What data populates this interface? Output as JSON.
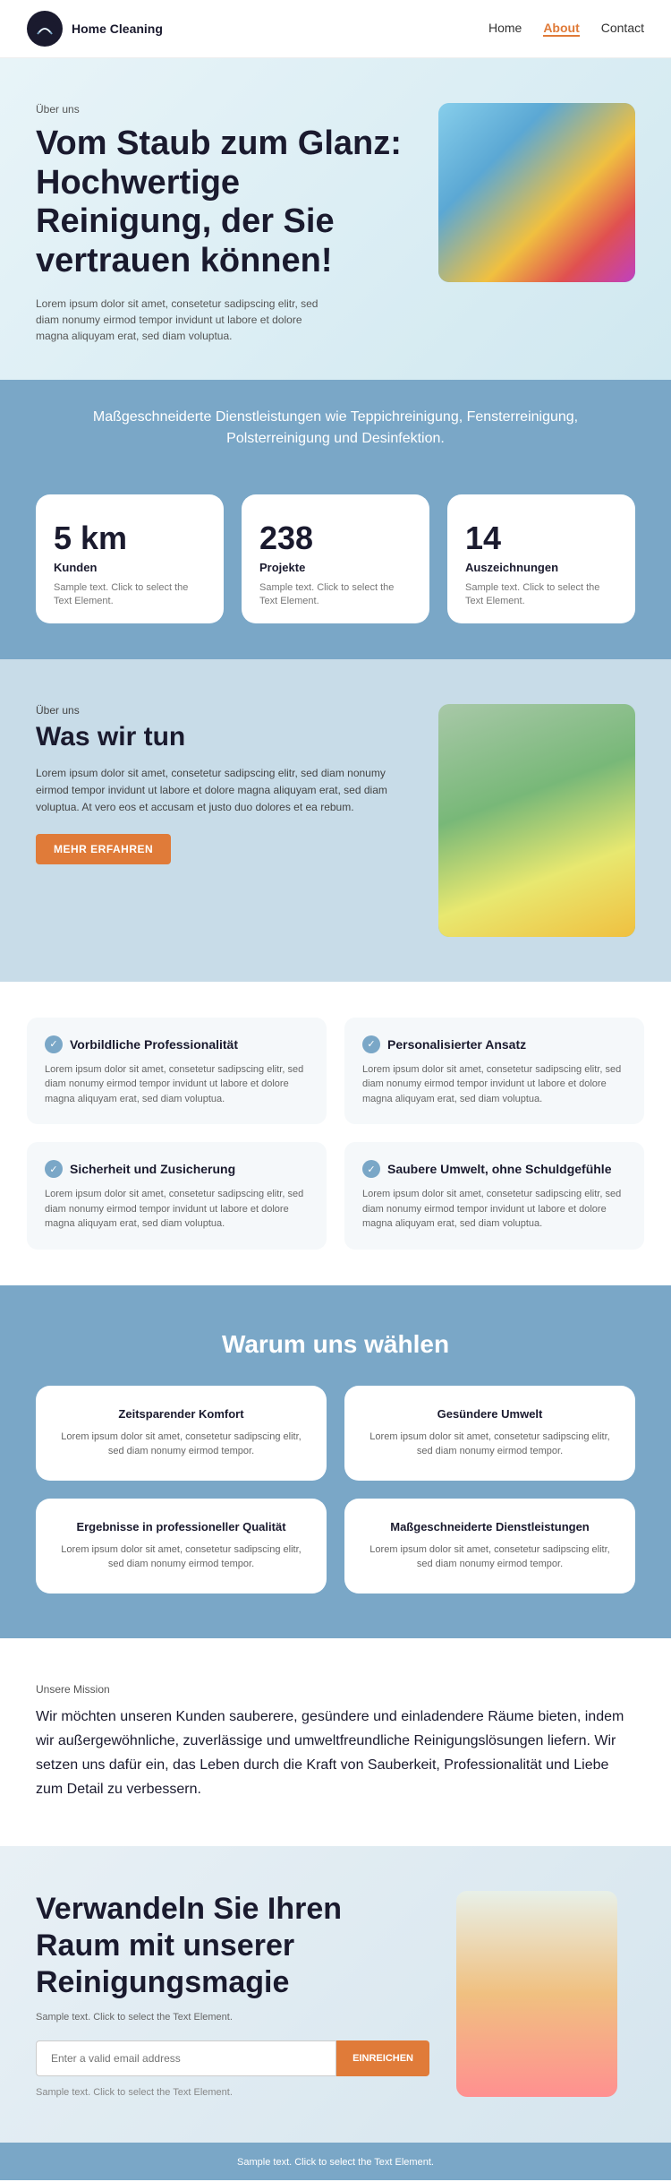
{
  "brand": {
    "name": "Home Cleaning",
    "logo_label": "Home Cleaning logo"
  },
  "nav": {
    "links": [
      {
        "label": "Home",
        "active": false
      },
      {
        "label": "About",
        "active": true
      },
      {
        "label": "Contact",
        "active": false
      }
    ]
  },
  "hero": {
    "label": "Über uns",
    "title": "Vom Staub zum Glanz: Hochwertige Reinigung, der Sie vertrauen können!",
    "text": "Lorem ipsum dolor sit amet, consetetur sadipscing elitr, sed diam nonumy eirmod tempor invidunt ut labore et dolore magna aliquyam erat, sed diam voluptua."
  },
  "services_banner": {
    "text": "Maßgeschneiderte Dienstleistungen wie Teppichreinigung, Fensterreinigung, Polsterreinigung und Desinfektion."
  },
  "stats": [
    {
      "number": "5 km",
      "label": "Kunden",
      "desc": "Sample text. Click to select the Text Element."
    },
    {
      "number": "238",
      "label": "Projekte",
      "desc": "Sample text. Click to select the Text Element."
    },
    {
      "number": "14",
      "label": "Auszeichnungen",
      "desc": "Sample text. Click to select the Text Element."
    }
  ],
  "about": {
    "label": "Über uns",
    "title": "Was wir tun",
    "text": "Lorem ipsum dolor sit amet, consetetur sadipscing elitr, sed diam nonumy eirmod tempor invidunt ut labore et dolore magna aliquyam erat, sed diam voluptua. At vero eos et accusam et justo duo dolores et ea rebum.",
    "button": "MEHR ERFAHREN"
  },
  "features": [
    {
      "title": "Vorbildliche Professionalität",
      "text": "Lorem ipsum dolor sit amet, consetetur sadipscing elitr, sed diam nonumy eirmod tempor invidunt ut labore et dolore magna aliquyam erat, sed diam voluptua."
    },
    {
      "title": "Personalisierter Ansatz",
      "text": "Lorem ipsum dolor sit amet, consetetur sadipscing elitr, sed diam nonumy eirmod tempor invidunt ut labore et dolore magna aliquyam erat, sed diam voluptua."
    },
    {
      "title": "Sicherheit und Zusicherung",
      "text": "Lorem ipsum dolor sit amet, consetetur sadipscing elitr, sed diam nonumy eirmod tempor invidunt ut labore et dolore magna aliquyam erat, sed diam voluptua."
    },
    {
      "title": "Saubere Umwelt, ohne Schuldgefühle",
      "text": "Lorem ipsum dolor sit amet, consetetur sadipscing elitr, sed diam nonumy eirmod tempor invidunt ut labore et dolore magna aliquyam erat, sed diam voluptua."
    }
  ],
  "why": {
    "title": "Warum uns wählen",
    "cards": [
      {
        "title": "Zeitsparender Komfort",
        "text": "Lorem ipsum dolor sit amet, consetetur sadipscing elitr, sed diam nonumy eirmod tempor."
      },
      {
        "title": "Gesündere Umwelt",
        "text": "Lorem ipsum dolor sit amet, consetetur sadipscing elitr, sed diam nonumy eirmod tempor."
      },
      {
        "title": "Ergebnisse in professioneller Qualität",
        "text": "Lorem ipsum dolor sit amet, consetetur sadipscing elitr, sed diam nonumy eirmod tempor."
      },
      {
        "title": "Maßgeschneiderte Dienstleistungen",
        "text": "Lorem ipsum dolor sit amet, consetetur sadipscing elitr, sed diam nonumy eirmod tempor."
      }
    ]
  },
  "mission": {
    "label": "Unsere Mission",
    "text": "Wir möchten unseren Kunden sauberere, gesündere und einladendere Räume bieten, indem wir außergewöhnliche, zuverlässige und umweltfreundliche Reinigungslösungen liefern. Wir setzen uns dafür ein, das Leben durch die Kraft von Sauberkeit, Professionalität und Liebe zum Detail zu verbessern."
  },
  "cta": {
    "title": "Verwandeln Sie Ihren Raum mit unserer Reinigungsmagie",
    "desc": "Sample text. Click to select the Text Element.",
    "input_placeholder": "Enter a valid email address",
    "button_label": "EINREICHEN",
    "small_text": "Sample text. Click to select the Text Element."
  }
}
